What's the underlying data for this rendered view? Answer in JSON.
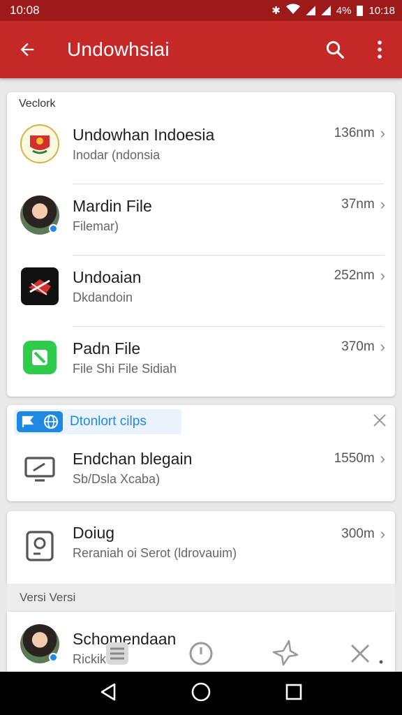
{
  "status_bar": {
    "time_left": "10:08",
    "battery_pct": "4%",
    "time_right": "10:18"
  },
  "app_bar": {
    "title": "Undowhsiai",
    "back_icon": "arrow-back-icon",
    "search_icon": "search-icon",
    "menu_icon": "more-vert-icon"
  },
  "section1": {
    "label": "Veclork",
    "items": [
      {
        "title": "Undowhan Indoesia",
        "subtitle": "Inodar (ndonsia",
        "meta": "136nm",
        "icon": "emblem-icon"
      },
      {
        "title": "Mardin File",
        "subtitle": "Filemar)",
        "meta": "37nm",
        "icon": "avatar"
      },
      {
        "title": "Undoaian",
        "subtitle": "Dkdandoin",
        "meta": "252nm",
        "icon": "dark-app-icon"
      },
      {
        "title": "Padn File",
        "subtitle": "File Shi File Sidiah",
        "meta": "370m",
        "icon": "green-app-icon"
      }
    ]
  },
  "section2": {
    "chip_label": "Dtonlort cilps",
    "item": {
      "title": "Endchan blegain",
      "subtitle": "Sb/Dsla Xcaba)",
      "meta": "1550m",
      "icon": "monitor-icon"
    }
  },
  "section3": {
    "item": {
      "title": "Doiug",
      "subtitle": "Reraniah oi Serot (ldrovauim)",
      "meta": "300m",
      "icon": "hard-drive-icon"
    }
  },
  "section4": {
    "header": "Versi Versi",
    "item": {
      "title": "Schomendaan",
      "subtitle": "Rickik"
    }
  },
  "colors": {
    "appbar": "#c62828",
    "statusbar": "#9e1a1a",
    "accent": "#1e88e5"
  }
}
